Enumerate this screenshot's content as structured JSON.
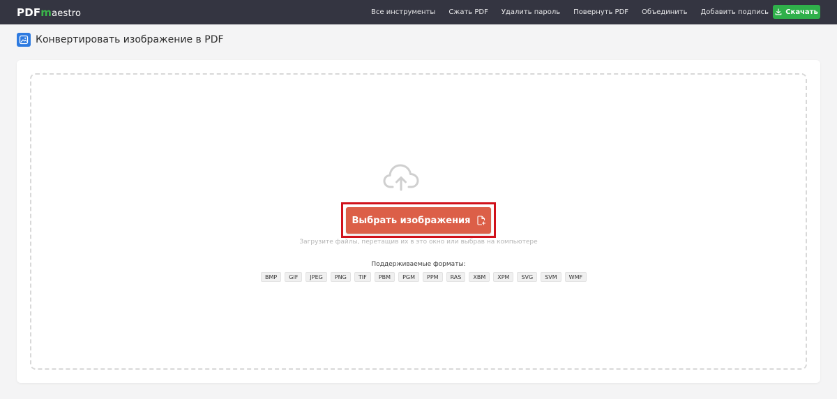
{
  "header": {
    "logo": {
      "prefix": "PDF",
      "m": "m",
      "rest": "aestro"
    },
    "nav": [
      "Все инструменты",
      "Сжать PDF",
      "Удалить пароль",
      "Повернуть PDF",
      "Объединить",
      "Добавить подпись"
    ],
    "download_label": "Скачать"
  },
  "page": {
    "title": "Конвертировать изображение в PDF"
  },
  "upload": {
    "select_label": "Выбрать изображения",
    "hint": "Загрузите файлы, перетащив их в это окно или выбрав на компьютере",
    "formats_label": "Поддерживаемые форматы:",
    "formats": [
      "BMP",
      "GIF",
      "JPEG",
      "PNG",
      "TIF",
      "PBM",
      "PGM",
      "PPM",
      "RAS",
      "XBM",
      "XPM",
      "SVG",
      "SVM",
      "WMF"
    ]
  },
  "colors": {
    "topbar": "#343541",
    "accent_green": "#2fb04a",
    "select_button": "#dc5f48",
    "highlight_frame": "#d0111b",
    "title_icon": "#2d7ae0"
  }
}
